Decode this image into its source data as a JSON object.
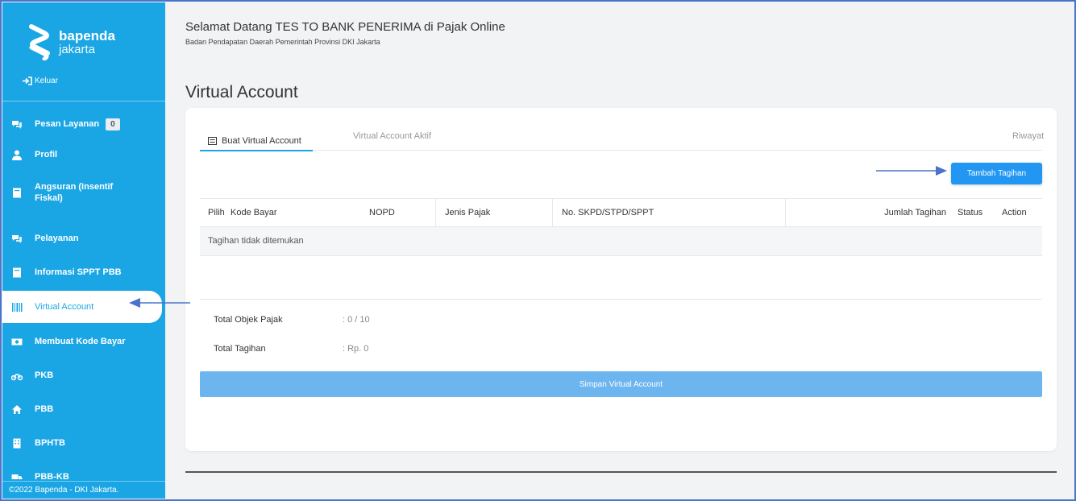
{
  "sidebar": {
    "brand_name": "bapenda",
    "brand_region": "jakarta",
    "logout_label": "Keluar",
    "items": [
      {
        "label": "Pesan Layanan",
        "icon": "chat-icon",
        "badge": "0"
      },
      {
        "label": "Profil",
        "icon": "user-icon"
      },
      {
        "label": "Angsuran (Insentif Fiskal)",
        "icon": "book-icon"
      },
      {
        "label": "Pelayanan",
        "icon": "chat-icon"
      },
      {
        "label": "Informasi SPPT PBB",
        "icon": "book-icon"
      },
      {
        "label": "Virtual Account",
        "icon": "barcode-icon",
        "active": true
      },
      {
        "label": "Membuat Kode Bayar",
        "icon": "money-icon"
      },
      {
        "label": "PKB",
        "icon": "motorcycle-icon"
      },
      {
        "label": "PBB",
        "icon": "home-icon"
      },
      {
        "label": "BPHTB",
        "icon": "building-icon"
      },
      {
        "label": "PBB-KB",
        "icon": "truck-icon"
      }
    ],
    "footer": "©2022 Bapenda - DKI Jakarta."
  },
  "header": {
    "welcome": "Selamat Datang TES TO BANK PENERIMA di Pajak Online",
    "subtitle": "Badan Pendapatan Daerah Pemerintah Provinsi DKI Jakarta"
  },
  "page": {
    "title": "Virtual Account",
    "tabs": [
      {
        "label": "Buat Virtual Account",
        "active": true
      },
      {
        "label": "Virtual Account Aktif"
      },
      {
        "label": "Riwayat"
      }
    ],
    "add_button": "Tambah Tagihan",
    "table": {
      "headers": [
        "Pilih",
        "Kode Bayar",
        "NOPD",
        "Jenis Pajak",
        "No. SKPD/STPD/SPPT",
        "Jumlah Tagihan",
        "Status",
        "Action"
      ],
      "empty_message": "Tagihan tidak ditemukan"
    },
    "summary": {
      "objek_label": "Total Objek Pajak",
      "objek_value": ": 0 / 10",
      "tagihan_label": "Total Tagihan",
      "tagihan_value": ": Rp. 0"
    },
    "save_button": "Simpan Virtual Account"
  },
  "colors": {
    "sidebar": "#1aa6e4",
    "primary_button": "#2196f3",
    "save_button": "#6cb5ee",
    "annotation_arrow": "#4a74c9"
  }
}
